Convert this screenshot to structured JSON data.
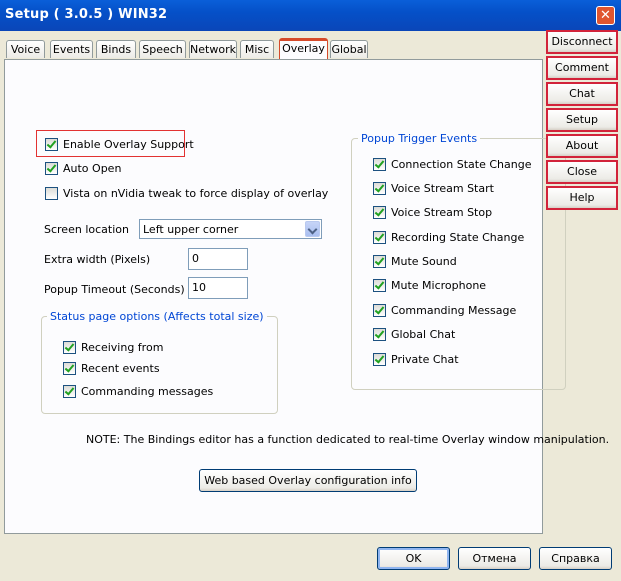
{
  "window": {
    "title": "Setup ( 3.0.5 ) WIN32",
    "close_glyph": "✕"
  },
  "tabs": [
    {
      "label": "Voice"
    },
    {
      "label": "Events"
    },
    {
      "label": "Binds"
    },
    {
      "label": "Speech"
    },
    {
      "label": "Network"
    },
    {
      "label": "Misc"
    },
    {
      "label": "Overlay",
      "active": true
    },
    {
      "label": "Global"
    }
  ],
  "overlay": {
    "enable_overlay": {
      "label": "Enable Overlay Support",
      "checked": true
    },
    "auto_open": {
      "label": "Auto Open",
      "checked": true
    },
    "vista_tweak": {
      "label": "Vista on nVidia tweak to force display of overlay",
      "checked": false
    },
    "screen_location": {
      "label": "Screen location",
      "value": "Left upper corner"
    },
    "extra_width": {
      "label": "Extra width (Pixels)",
      "value": "0"
    },
    "popup_timeout": {
      "label": "Popup Timeout (Seconds)",
      "value": "10"
    },
    "status_group": {
      "title": "Status page options (Affects total size)",
      "items": [
        {
          "label": "Receiving from",
          "checked": true
        },
        {
          "label": "Recent events",
          "checked": true
        },
        {
          "label": "Commanding messages",
          "checked": true
        }
      ]
    },
    "popup_group": {
      "title": "Popup Trigger Events",
      "items": [
        {
          "label": "Connection State Change",
          "checked": true
        },
        {
          "label": "Voice Stream Start",
          "checked": true
        },
        {
          "label": "Voice Stream Stop",
          "checked": true
        },
        {
          "label": "Recording State Change",
          "checked": true
        },
        {
          "label": "Mute Sound",
          "checked": true
        },
        {
          "label": "Mute Microphone",
          "checked": true
        },
        {
          "label": "Commanding Message",
          "checked": true
        },
        {
          "label": "Global Chat",
          "checked": true
        },
        {
          "label": "Private Chat",
          "checked": true
        }
      ]
    },
    "note": "NOTE: The Bindings editor has a function dedicated to real-time Overlay window manipulation.",
    "web_config_button": "Web based Overlay configuration info"
  },
  "footer": {
    "ok": "OK",
    "cancel": "Отмена",
    "help": "Справка"
  },
  "side_buttons": [
    {
      "label": "Disconnect"
    },
    {
      "label": "Comment"
    },
    {
      "label": "Chat"
    },
    {
      "label": "Setup"
    },
    {
      "label": "About"
    },
    {
      "label": "Close"
    },
    {
      "label": "Help"
    }
  ],
  "colors": {
    "highlight_red": "#e23232",
    "group_title_blue": "#0046d5",
    "titlebar_blue": "#0550c8",
    "check_green": "#21a121"
  }
}
